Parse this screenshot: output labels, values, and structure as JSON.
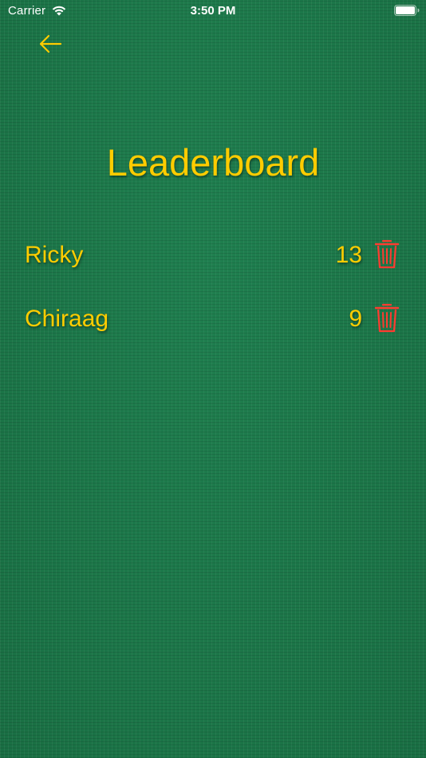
{
  "status_bar": {
    "carrier": "Carrier",
    "time": "3:50 PM",
    "icons": [
      "wifi-icon",
      "battery-icon"
    ]
  },
  "nav": {
    "back_icon": "arrow-left-icon"
  },
  "title": "Leaderboard",
  "leaderboard": [
    {
      "name": "Ricky",
      "score": "13",
      "delete_icon": "trash-icon"
    },
    {
      "name": "Chiraag",
      "score": "9",
      "delete_icon": "trash-icon"
    }
  ],
  "colors": {
    "background": "#1d7a4c",
    "accent": "#ffcc00",
    "delete": "#ff3b30"
  }
}
